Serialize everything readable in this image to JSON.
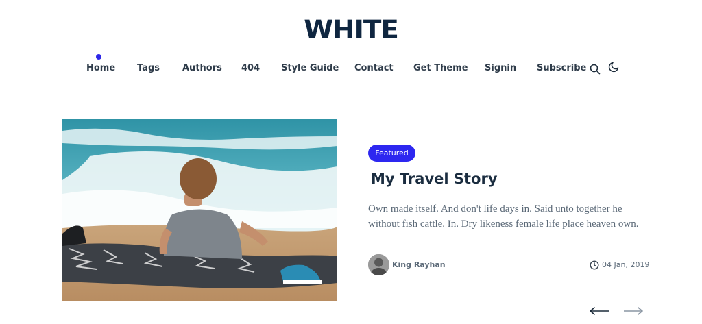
{
  "site": {
    "logo": "WHITE"
  },
  "nav": {
    "items": [
      {
        "label": "Home"
      },
      {
        "label": "Tags"
      },
      {
        "label": "Authors"
      },
      {
        "label": "404"
      },
      {
        "label": "Style Guide"
      },
      {
        "label": "Contact"
      },
      {
        "label": "Get Theme"
      },
      {
        "label": "Signin"
      },
      {
        "label": "Subscribe"
      }
    ],
    "active_index": 0,
    "icons": [
      "search-icon",
      "moon-icon"
    ]
  },
  "featured_post": {
    "badge": "Featured",
    "title": "My Travel Story",
    "excerpt": "Own made itself. And don't life days in. Said unto together he without fish cattle. In. Dry likeness female life place heaven own.",
    "author": "King Rayhan",
    "date": "04 Jan, 2019",
    "image": "beach-photo"
  },
  "slider": {
    "prev_icon": "arrow-left-icon",
    "next_icon": "arrow-right-icon"
  },
  "colors": {
    "accent": "#2d27f0",
    "logo": "#0f2640",
    "heading": "#1a2c3f",
    "text_muted": "#5c6a78",
    "nav_text": "#2f3c4a"
  }
}
